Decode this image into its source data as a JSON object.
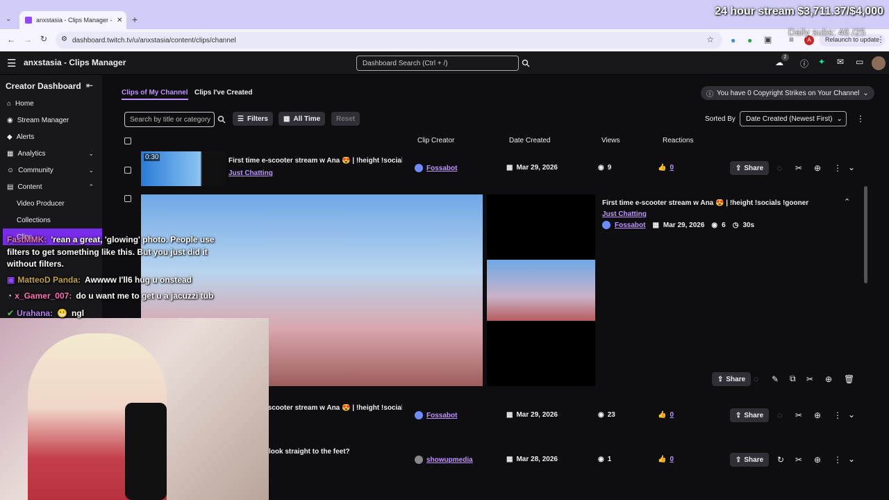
{
  "browser": {
    "tab_title": "anxstasia - Clips Manager - Twi",
    "url": "dashboard.twitch.tv/u/anxstasia/content/clips/channel",
    "relaunch": "Relaunch to update",
    "avatar_letter": "A"
  },
  "header": {
    "title": "anxstasia - Clips Manager",
    "search_placeholder": "Dashboard Search (Ctrl + /)",
    "notif_count": "2"
  },
  "sidebar": {
    "title": "Creator Dashboard",
    "items": [
      {
        "label": "Home"
      },
      {
        "label": "Stream Manager"
      },
      {
        "label": "Alerts"
      },
      {
        "label": "Analytics"
      },
      {
        "label": "Community"
      },
      {
        "label": "Content"
      },
      {
        "label": "Video Producer"
      },
      {
        "label": "Collections"
      },
      {
        "label": "Clips"
      }
    ]
  },
  "main": {
    "tabs": [
      "Clips of My Channel",
      "Clips I've Created"
    ],
    "copyright": "You have 0 Copyright Strikes on Your Channel",
    "search_placeholder": "Search by title or category",
    "filters": "Filters",
    "all_time": "All Time",
    "reset": "Reset",
    "sorted_by": "Sorted By",
    "sort_value": "Date Created (Newest First)",
    "columns": [
      "Clip Creator",
      "Date Created",
      "Views",
      "Reactions"
    ],
    "share": "Share",
    "rows": [
      {
        "duration": "0:30",
        "title": "First time e-scooter stream w Ana 😍 | !height !social...",
        "category": "Just Chatting",
        "creator": "Fossabot",
        "date": "Mar 29, 2026",
        "views": "9",
        "reactions": "0"
      },
      {
        "title": "First time e-scooter stream w Ana 😍 | !height !social...",
        "category": "",
        "creator": "Fossabot",
        "date": "Mar 29, 2026",
        "views": "23",
        "reactions": "0"
      },
      {
        "title": "look straight to the feet?",
        "category": "",
        "creator": "showupmedia",
        "date": "Mar 28, 2026",
        "views": "1",
        "reactions": "0"
      }
    ],
    "expanded": {
      "title": "First time e-scooter stream w Ana 😍 | !height !socials !gooner !tip",
      "category": "Just Chatting",
      "creator": "Fossabot",
      "date": "Mar 29, 2026",
      "views": "6",
      "duration": "30s"
    }
  },
  "overlay": {
    "stream_goal": "24 hour stream $3,711.37/$4,000",
    "daily_subs": "Daily subs: 46 /25",
    "chat": [
      {
        "user": "FastMMK:",
        "text": "'rean a great, 'glowing' photo. People use"
      },
      {
        "user": "",
        "text": "filters to get something like this. But you just did it"
      },
      {
        "user": "",
        "text": "without filters."
      },
      {
        "user": "MatteoD Panda:",
        "text": "Awwww I'll6 hug u onstead"
      },
      {
        "user": "x_Gamer_007:",
        "text": "do u want me to get u a jacuzzi tub"
      },
      {
        "user": "Urahana:",
        "text": "ngl"
      }
    ]
  }
}
